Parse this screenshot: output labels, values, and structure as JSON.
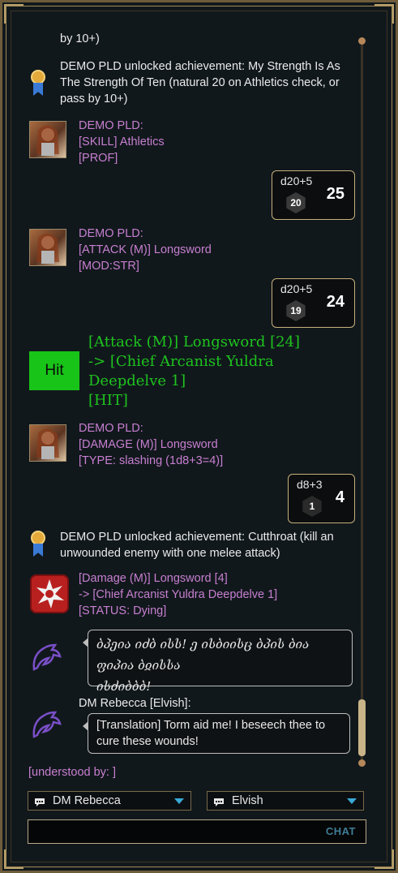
{
  "log": {
    "top_fragment": "by 10+)",
    "achievement1": {
      "text": "DEMO PLD unlocked achievement: My Strength Is As The Strength Of Ten (natural 20 on Athletics check, or pass by 10+)",
      "icon": "ribbon-medal-icon"
    },
    "msg1": {
      "sender": "DEMO PLD:",
      "line1": "[SKILL] Athletics",
      "line2": "[PROF]"
    },
    "roll1": {
      "formula": "d20+5",
      "die": "20",
      "total": "25"
    },
    "msg2": {
      "sender": "DEMO PLD:",
      "line1": "[ATTACK (M)] Longsword",
      "line2": "[MOD:STR]"
    },
    "roll2": {
      "formula": "d20+5",
      "die": "19",
      "total": "24"
    },
    "hit": {
      "badge": "Hit",
      "line1": "[Attack (M)] Longsword [24]",
      "line2": "-> [Chief Arcanist Yuldra",
      "line3": "Deepdelve 1]",
      "line4": "[HIT]"
    },
    "msg3": {
      "sender": "DEMO PLD:",
      "line1": "[DAMAGE (M)] Longsword",
      "line2": "[TYPE: slashing (1d8+3=4)]"
    },
    "roll3": {
      "formula": "d8+3",
      "die": "1",
      "total": "4"
    },
    "achievement2": {
      "text": "DEMO PLD unlocked achievement: Cutthroat (kill an unwounded enemy with one melee attack)",
      "icon": "ribbon-medal-icon"
    },
    "damage": {
      "line1": "[Damage (M)] Longsword [4]",
      "line2": "-> [Chief Arcanist Yuldra Deepdelve 1]",
      "line3": "[STATUS: Dying]"
    },
    "elvish": {
      "line1": "ბპეია იძბ ისს! ე ისბიისც ბპის ბია ფიპია ბჲისსა",
      "line2": "ისძიბბბ!"
    },
    "dm": {
      "sender": "DM Rebecca [Elvish]:",
      "translation": "[Translation] Torm aid me! I beseech thee to cure these wounds!"
    }
  },
  "understood_by": "[understood by: ]",
  "controls": {
    "speaker": "DM Rebecca",
    "language": "Elvish",
    "chat_button": "CHAT"
  }
}
